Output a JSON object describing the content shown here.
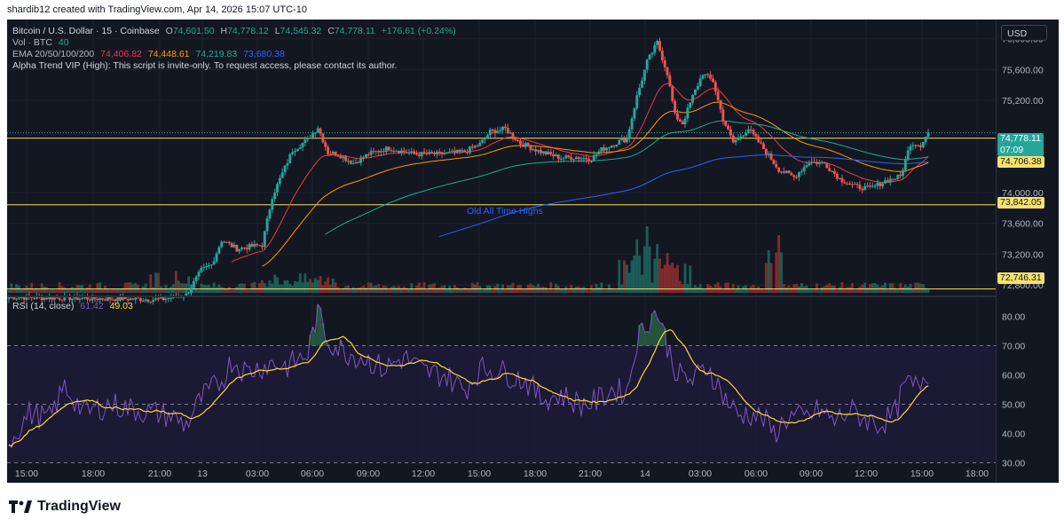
{
  "header": {
    "watermark": "shardib12 created with TradingView.com, Apr 14, 2026 15:07 UTC-10"
  },
  "legend": {
    "symbol": "Bitcoin / U.S. Dollar · 15 · Coinbase",
    "open_label": "O",
    "open": "74,601.50",
    "high_label": "H",
    "high": "74,778.12",
    "low_label": "L",
    "low": "74,545.32",
    "close_label": "C",
    "close": "74,778.11",
    "change": "+176.61 (+0.24%)",
    "vol_label": "Vol · BTC",
    "vol_value": "40",
    "ema_label": "EMA 20/50/100/200",
    "ema20": "74,406.82",
    "ema50": "74,448.61",
    "ema100": "74,219.83",
    "ema200": "73,680.38",
    "script_note": "Alpha Trend VIP (High): This script is invite-only. To request access, please contact its author.",
    "rsi_label": "RSI (14, close)",
    "rsi_value": "61.42",
    "rsi_ma": "49.03"
  },
  "currency_button": "USD",
  "annotation": "Old All Time Highs",
  "price_tags": {
    "last_price": "74,778.11",
    "countdown": "07:09",
    "level1": "74,706.38",
    "level2": "73,842.05",
    "level3": "72,746.31"
  },
  "brand": "TradingView",
  "colors": {
    "background": "#131722",
    "up": "#26a69a",
    "down": "#ef5350",
    "ema20": "#f23645",
    "ema50": "#ff9800",
    "ema100": "#22ab94",
    "ema200": "#2962ff",
    "hline": "#f7e06b",
    "rsi": "#7e57c2",
    "rsi_ma": "#fdd835"
  },
  "chart_data": {
    "type": "candlestick",
    "time_axis": [
      "15:00",
      "18:00",
      "21:00",
      "13",
      "03:00",
      "06:00",
      "09:00",
      "12:00",
      "15:00",
      "18:00",
      "21:00",
      "14",
      "03:00",
      "06:00",
      "09:00",
      "12:00",
      "15:00",
      "18:00"
    ],
    "price_axis": [
      "76,000.00",
      "75,600.00",
      "75,200.00",
      "74,000.00",
      "73,600.00",
      "73,200.00",
      "72,800.00"
    ],
    "price_range": [
      72650,
      76250
    ],
    "horizontal_levels": [
      74706.38,
      73842.05,
      72746.31
    ],
    "anchors": [
      [
        0,
        72640
      ],
      [
        60,
        72610
      ],
      [
        70,
        72670
      ],
      [
        76,
        72990
      ],
      [
        80,
        73060
      ],
      [
        84,
        73380
      ],
      [
        90,
        73270
      ],
      [
        96,
        73300
      ],
      [
        100,
        73320
      ],
      [
        104,
        73950
      ],
      [
        108,
        74250
      ],
      [
        112,
        74550
      ],
      [
        118,
        74690
      ],
      [
        122,
        74850
      ],
      [
        126,
        74520
      ],
      [
        130,
        74500
      ],
      [
        136,
        74380
      ],
      [
        142,
        74500
      ],
      [
        150,
        74580
      ],
      [
        160,
        74500
      ],
      [
        170,
        74500
      ],
      [
        180,
        74530
      ],
      [
        186,
        74630
      ],
      [
        190,
        74790
      ],
      [
        196,
        74830
      ],
      [
        202,
        74640
      ],
      [
        210,
        74530
      ],
      [
        218,
        74450
      ],
      [
        224,
        74460
      ],
      [
        230,
        74440
      ],
      [
        234,
        74560
      ],
      [
        240,
        74650
      ],
      [
        244,
        74700
      ],
      [
        248,
        75250
      ],
      [
        252,
        75700
      ],
      [
        256,
        75950
      ],
      [
        260,
        75550
      ],
      [
        263,
        75000
      ],
      [
        266,
        74900
      ],
      [
        270,
        75250
      ],
      [
        274,
        75550
      ],
      [
        278,
        75450
      ],
      [
        282,
        74950
      ],
      [
        286,
        74650
      ],
      [
        292,
        74830
      ],
      [
        298,
        74570
      ],
      [
        304,
        74300
      ],
      [
        310,
        74200
      ],
      [
        316,
        74400
      ],
      [
        322,
        74380
      ],
      [
        328,
        74180
      ],
      [
        334,
        74080
      ],
      [
        340,
        74050
      ],
      [
        346,
        74150
      ],
      [
        352,
        74210
      ],
      [
        356,
        74640
      ],
      [
        360,
        74620
      ],
      [
        363,
        74780
      ]
    ],
    "volume_spikes": [
      [
        248,
        60
      ],
      [
        252,
        75
      ],
      [
        256,
        55
      ],
      [
        260,
        45
      ],
      [
        300,
        48
      ],
      [
        304,
        65
      ]
    ],
    "rsi_axis": [
      "80.00",
      "70.00",
      "60.00",
      "50.00",
      "40.00",
      "30.00"
    ],
    "rsi_range": [
      25,
      85
    ],
    "rsi_bands": [
      70,
      50,
      30
    ],
    "rsi_anchors": [
      [
        0,
        37
      ],
      [
        8,
        47
      ],
      [
        16,
        45
      ],
      [
        22,
        56
      ],
      [
        30,
        47
      ],
      [
        40,
        50
      ],
      [
        50,
        48
      ],
      [
        58,
        47
      ],
      [
        64,
        46
      ],
      [
        70,
        43
      ],
      [
        76,
        52
      ],
      [
        84,
        58
      ],
      [
        88,
        65
      ],
      [
        94,
        61
      ],
      [
        100,
        63
      ],
      [
        104,
        64
      ],
      [
        110,
        63
      ],
      [
        118,
        67
      ],
      [
        122,
        82
      ],
      [
        126,
        72
      ],
      [
        132,
        68
      ],
      [
        140,
        66
      ],
      [
        148,
        62
      ],
      [
        156,
        66
      ],
      [
        164,
        61
      ],
      [
        172,
        60
      ],
      [
        180,
        55
      ],
      [
        186,
        62
      ],
      [
        192,
        62
      ],
      [
        198,
        60
      ],
      [
        204,
        58
      ],
      [
        210,
        52
      ],
      [
        218,
        53
      ],
      [
        226,
        50
      ],
      [
        232,
        51
      ],
      [
        238,
        55
      ],
      [
        244,
        54
      ],
      [
        248,
        72
      ],
      [
        252,
        78
      ],
      [
        256,
        82
      ],
      [
        260,
        70
      ],
      [
        264,
        60
      ],
      [
        270,
        58
      ],
      [
        276,
        63
      ],
      [
        282,
        53
      ],
      [
        288,
        46
      ],
      [
        292,
        47
      ],
      [
        298,
        45
      ],
      [
        302,
        40
      ],
      [
        308,
        46
      ],
      [
        314,
        45
      ],
      [
        320,
        48
      ],
      [
        326,
        44
      ],
      [
        332,
        48
      ],
      [
        338,
        45
      ],
      [
        344,
        43
      ],
      [
        350,
        47
      ],
      [
        354,
        57
      ],
      [
        358,
        56
      ],
      [
        363,
        61
      ]
    ]
  }
}
